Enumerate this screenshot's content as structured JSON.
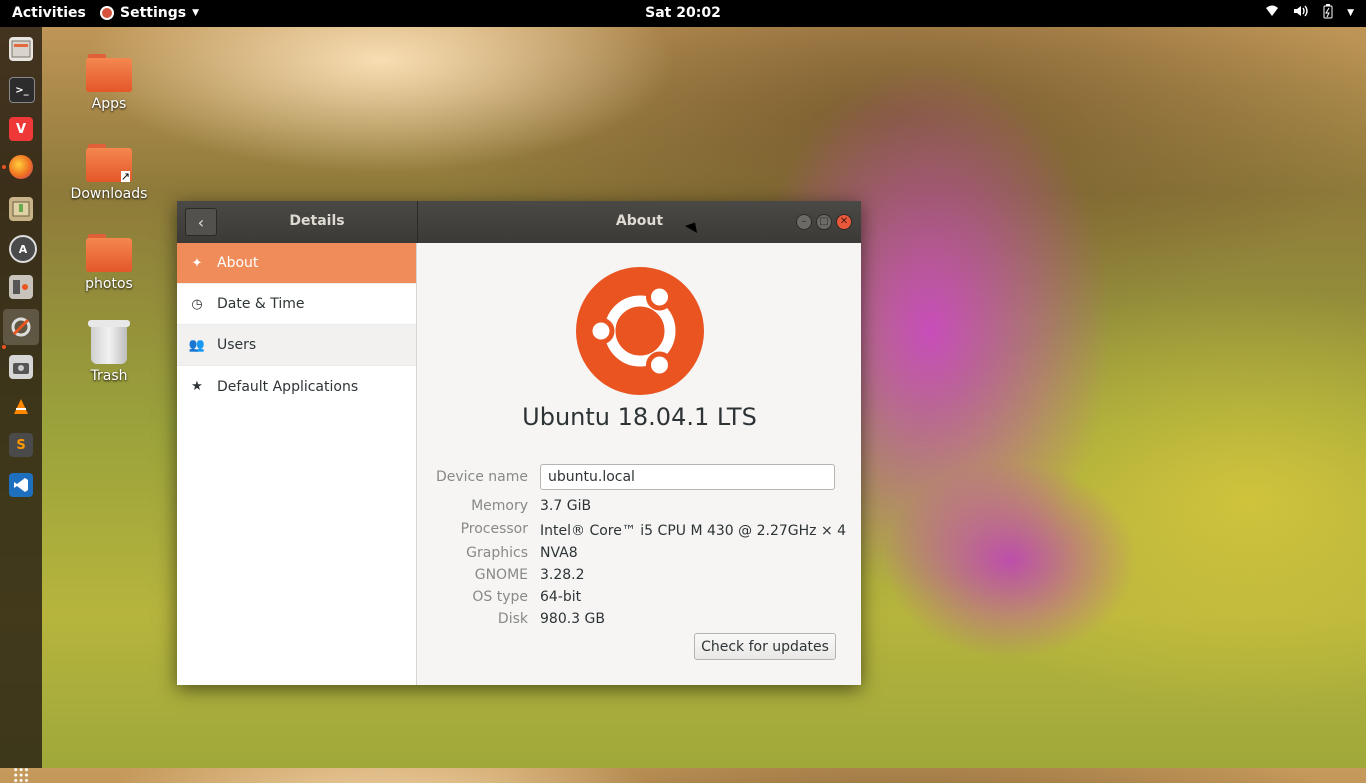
{
  "topbar": {
    "activities": "Activities",
    "app_menu": "Settings",
    "clock": "Sat 20:02",
    "icons": [
      "wifi-icon",
      "volume-icon",
      "battery-icon",
      "system-menu-arrow"
    ]
  },
  "dock": {
    "items": [
      "files",
      "terminal",
      "vivaldi",
      "firefox",
      "archive-manager",
      "software-updater",
      "system-monitor",
      "settings",
      "screenshot",
      "vlc",
      "sublime-text",
      "vscode"
    ],
    "active": "settings"
  },
  "desktop": {
    "icons": [
      {
        "label": "Apps",
        "type": "folder"
      },
      {
        "label": "Downloads",
        "type": "folder-link"
      },
      {
        "label": "photos",
        "type": "folder"
      },
      {
        "label": "Trash",
        "type": "trash"
      }
    ]
  },
  "window": {
    "left_title": "Details",
    "title": "About",
    "sidebar": [
      {
        "label": "About",
        "icon": "sparkle-icon",
        "selected": true
      },
      {
        "label": "Date & Time",
        "icon": "clock-icon"
      },
      {
        "label": "Users",
        "icon": "users-icon"
      },
      {
        "label": "Default Applications",
        "icon": "star-icon"
      }
    ],
    "os_name": "Ubuntu 18.04.1 LTS",
    "device_name_label": "Device name",
    "device_name_value": "ubuntu.local",
    "info": [
      {
        "label": "Memory",
        "value": "3.7 GiB"
      },
      {
        "label": "Processor",
        "value": "Intel® Core™ i5 CPU M 430 @ 2.27GHz × 4"
      },
      {
        "label": "Graphics",
        "value": "NVA8"
      },
      {
        "label": "GNOME",
        "value": "3.28.2"
      },
      {
        "label": "OS type",
        "value": "64-bit"
      },
      {
        "label": "Disk",
        "value": "980.3 GB"
      }
    ],
    "update_button": "Check for updates"
  },
  "colors": {
    "accent": "#f08c5a",
    "ubuntu_orange": "#e95420",
    "topbar": "#000000",
    "close_button": "#e9583b"
  }
}
